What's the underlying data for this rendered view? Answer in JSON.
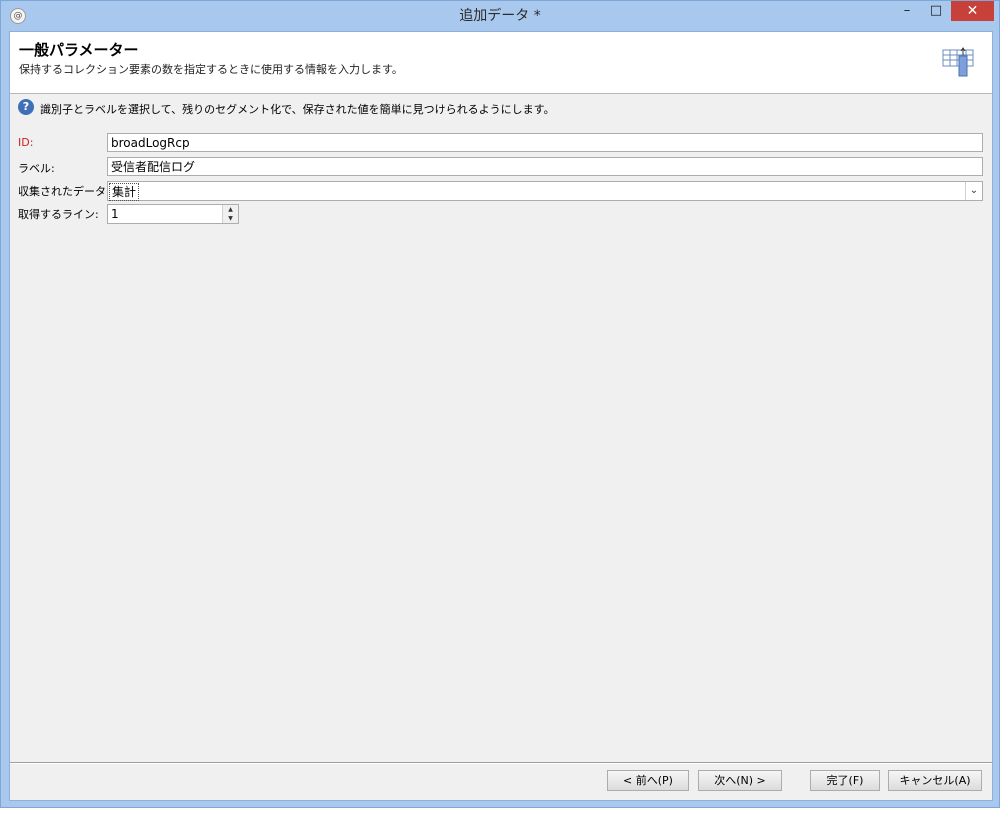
{
  "window": {
    "title": "追加データ *",
    "app_icon": "app-logo-icon",
    "controls": {
      "minimize": "–",
      "maximize": "□",
      "close": "✕"
    }
  },
  "header": {
    "title": "一般パラメーター",
    "subtitle": "保持するコレクション要素の数を指定するときに使用する情報を入力します。",
    "icon": "table-columns-icon"
  },
  "info": {
    "icon": "help-icon",
    "glyph": "?",
    "text": "識別子とラベルを選択して、残りのセグメント化で、保存された値を簡単に見つけられるようにします。"
  },
  "form": {
    "id": {
      "label": "ID:",
      "value": "broadLogRcp"
    },
    "label": {
      "label": "ラベル:",
      "value": "受信者配信ログ"
    },
    "collected_data": {
      "label": "収集されたデータ:",
      "value": "集計"
    },
    "lines": {
      "label": "取得するライン:",
      "value": "1"
    }
  },
  "buttons": {
    "prev": "< 前へ(P)",
    "next": "次へ(N) >",
    "finish": "完了(F)",
    "cancel": "キャンセル(A)"
  },
  "colors": {
    "frame": "#a9c8ee",
    "close": "#c7403a",
    "required_label": "#cc2222",
    "info_icon": "#3f6fb6"
  }
}
